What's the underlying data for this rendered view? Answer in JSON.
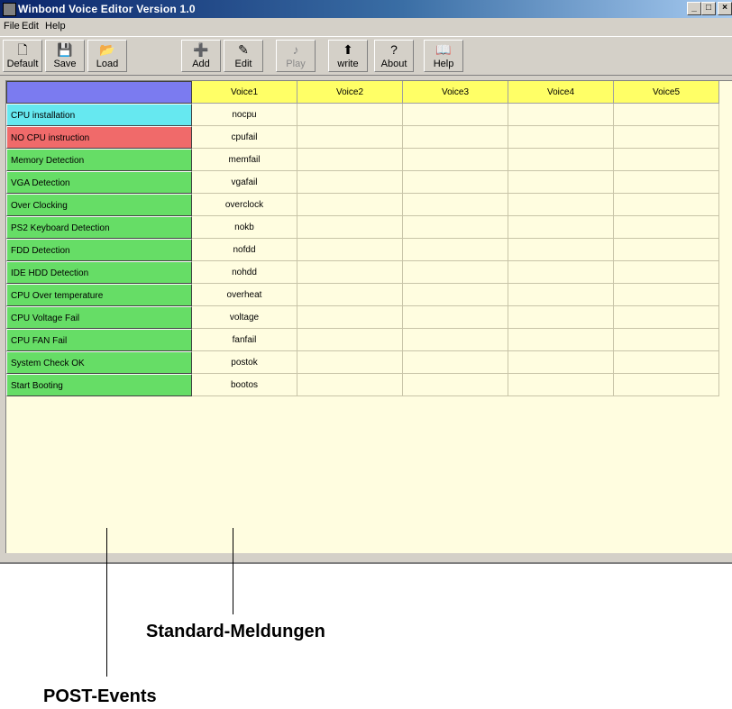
{
  "window": {
    "title": "Winbond Voice Editor   Version 1.0",
    "controls": {
      "minimize": "_",
      "maximize": "□",
      "close": "×"
    }
  },
  "menu": [
    "File",
    "Edit",
    "Help"
  ],
  "toolbar": [
    {
      "label": "Default",
      "icon": "new-document-icon",
      "glyph": "🗋",
      "enabled": true
    },
    {
      "label": "Save",
      "icon": "floppy-disk-icon",
      "glyph": "💾",
      "enabled": true
    },
    {
      "label": "Load",
      "icon": "open-folder-icon",
      "glyph": "📂",
      "enabled": true
    },
    {
      "label": "Add",
      "icon": "add-voice-icon",
      "glyph": "➕",
      "enabled": true
    },
    {
      "label": "Edit",
      "icon": "edit-voice-icon",
      "glyph": "✎",
      "enabled": true
    },
    {
      "label": "Play",
      "icon": "play-icon",
      "glyph": "♪",
      "enabled": false
    },
    {
      "label": "write",
      "icon": "write-chip-icon",
      "glyph": "⬆",
      "enabled": true
    },
    {
      "label": "About",
      "icon": "question-icon",
      "glyph": "?",
      "enabled": true
    },
    {
      "label": "Help",
      "icon": "help-book-icon",
      "glyph": "📖",
      "enabled": true
    }
  ],
  "grid": {
    "columns": [
      "Voice1",
      "Voice2",
      "Voice3",
      "Voice4",
      "Voice5"
    ],
    "rows": [
      {
        "event": "CPU installation",
        "color": "#66e8f0",
        "voice1": "nocpu"
      },
      {
        "event": "NO CPU instruction",
        "color": "#f06a6a",
        "voice1": "cpufail"
      },
      {
        "event": "Memory Detection",
        "color": "#66dd66",
        "voice1": "memfail"
      },
      {
        "event": "VGA Detection",
        "color": "#66dd66",
        "voice1": "vgafail"
      },
      {
        "event": "Over Clocking",
        "color": "#66dd66",
        "voice1": "overclock"
      },
      {
        "event": "PS2 Keyboard Detection",
        "color": "#66dd66",
        "voice1": "nokb"
      },
      {
        "event": "FDD Detection",
        "color": "#66dd66",
        "voice1": "nofdd"
      },
      {
        "event": "IDE HDD Detection",
        "color": "#66dd66",
        "voice1": "nohdd"
      },
      {
        "event": "CPU Over temperature",
        "color": "#66dd66",
        "voice1": "overheat"
      },
      {
        "event": "CPU Voltage Fail",
        "color": "#66dd66",
        "voice1": "voltage"
      },
      {
        "event": "CPU FAN Fail",
        "color": "#66dd66",
        "voice1": "fanfail"
      },
      {
        "event": "System Check OK",
        "color": "#66dd66",
        "voice1": "postok"
      },
      {
        "event": "Start Booting",
        "color": "#66dd66",
        "voice1": "bootos"
      }
    ],
    "corner_color": "#7b7bf0",
    "header_color": "#ffff66"
  },
  "annotations": {
    "standard": "Standard-Meldungen",
    "post": "POST-Events"
  }
}
